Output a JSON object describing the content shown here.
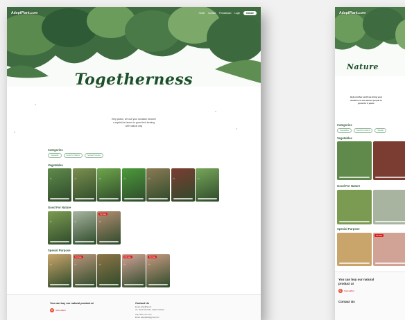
{
  "left": {
    "nav": {
      "logo": "AdoptPlant.com",
      "links": [
        "Home",
        "Contact",
        "Perusahaan",
        "Login"
      ],
      "donate": "Donate"
    },
    "hero_title": "Togetherness",
    "intro_lines": [
      "Help peace, we use your donation become",
      "a capital for farmer to grow their farming",
      "with natural way"
    ],
    "categories_title": "Categories",
    "chips": [
      "Vegetable",
      "Good For Nature",
      "Spesial Purpose"
    ],
    "sections": [
      {
        "title": "Vegetables",
        "cards": [
          {
            "color": "#5f8a4b",
            "badge": ""
          },
          {
            "color": "#7b8f4f",
            "badge": ""
          },
          {
            "color": "#6ea64a",
            "badge": ""
          },
          {
            "color": "#4c9a3c",
            "badge": ""
          },
          {
            "color": "#8b7a55",
            "badge": ""
          },
          {
            "color": "#7b3d32",
            "badge": ""
          },
          {
            "color": "#77a65a",
            "badge": ""
          }
        ]
      },
      {
        "title": "Good For Nature",
        "cards": [
          {
            "color": "#7c9b52",
            "badge": ""
          },
          {
            "color": "#a8b4a0",
            "badge": ""
          },
          {
            "color": "#b38d73",
            "badge": "Hot Sale"
          }
        ]
      },
      {
        "title": "Spesial Purpose",
        "cards": [
          {
            "color": "#c9a56b",
            "badge": ""
          },
          {
            "color": "#b9967c",
            "badge": "Hot Sale"
          },
          {
            "color": "#8d7447",
            "badge": ""
          },
          {
            "color": "#d0a396",
            "badge": "Hot Sale"
          },
          {
            "color": "#c79a82",
            "badge": "Hot Sale"
          }
        ]
      }
    ],
    "footer": {
      "buy_title": "You can buy our natural product at",
      "brand": "SubmaBell",
      "contact_title": "Contact Us",
      "contact_lines": [
        "Email: AdoptPlant.id",
        "Jln. Tanah Merdeka, Jakarta Selatan",
        "Telp: 08xx-xxxx-xxxx",
        "Email: adoptplant@gmail.com"
      ]
    }
  },
  "right": {
    "logo": "AdoptPlant.com",
    "hero_title": "Nature",
    "intro_lines": [
      "Help mother earth we bring your",
      "donation to the farmer people to",
      "grow for 3 years"
    ],
    "categories_title": "Categories",
    "chips": [
      "Vegetables",
      "Good For Nature",
      "Spesial"
    ],
    "section_titles": [
      "Vegetables",
      "Good For Nature",
      "Spesial Purpose"
    ],
    "buy_title_lines": [
      "You can buy our natural",
      "product at"
    ],
    "brand": "SubmaBell",
    "contact_title": "Contact Us"
  },
  "colors": {
    "brand_green": "#1d4f2b",
    "hot_sale": "#d9201e"
  }
}
